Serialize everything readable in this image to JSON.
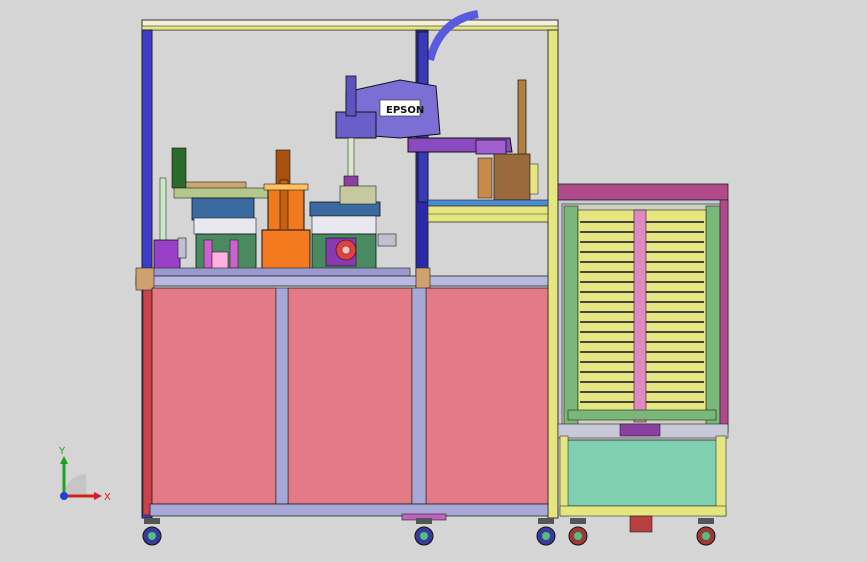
{
  "robot": {
    "brand": "EPSON"
  },
  "triad": {
    "x_label": "X",
    "y_label": "Y"
  },
  "colors": {
    "background": "#d5d5d5",
    "cabinet_panel": "#e37a85",
    "frame_blue": "#3c3cc8",
    "frame_yellow": "#e6e680",
    "robot_body": "#7b6fd6",
    "orange_part": "#f07a20",
    "teal_drawer": "#7fd0b0",
    "magazine_purple": "#b04a8a",
    "tray_green": "#7ab87a"
  }
}
